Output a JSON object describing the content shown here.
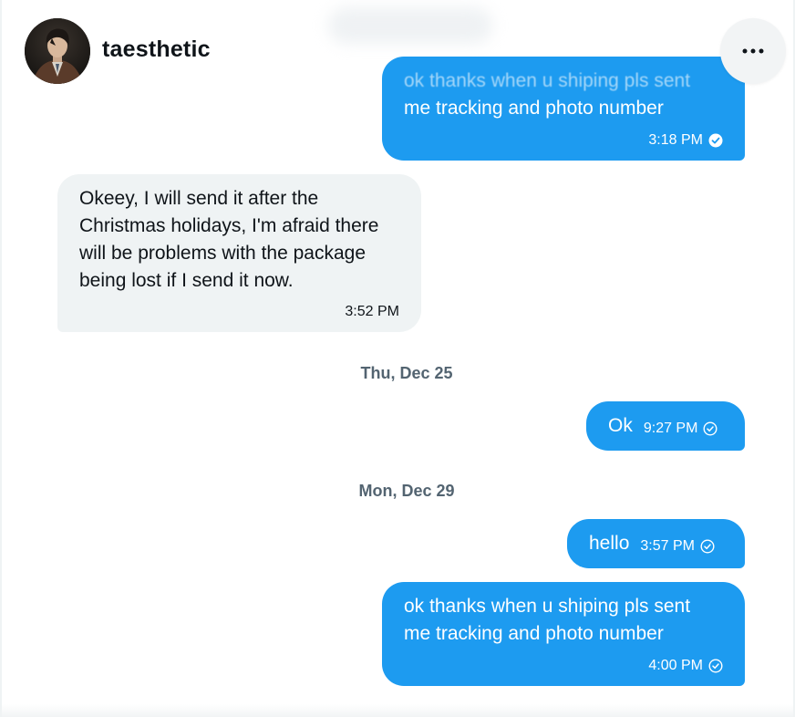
{
  "header": {
    "user_name": "taesthetic",
    "avatar_icon": "avatar-photo"
  },
  "conversation": {
    "messages": [
      {
        "direction": "outgoing",
        "text_line1": "ok thanks when u shiping pls sent",
        "text_line2": "me tracking and photo number",
        "time": "3:18 PM",
        "status": "read"
      },
      {
        "direction": "incoming",
        "text": "Okeey, I will send it after the Christmas holidays, I'm afraid there will be problems with the package being lost if I send it now.",
        "time": "3:52 PM"
      },
      {
        "direction": "outgoing",
        "text": "Ok",
        "time": "9:27 PM",
        "status": "sent"
      },
      {
        "direction": "outgoing",
        "text": "hello",
        "time": "3:57 PM",
        "status": "sent"
      },
      {
        "direction": "outgoing",
        "text_line1": "ok thanks when u shiping pls sent",
        "text_line2": "me tracking and photo number",
        "time": "4:00 PM",
        "status": "sent"
      }
    ],
    "date_separators": [
      "Thu, Dec 25",
      "Mon, Dec 29"
    ]
  },
  "colors": {
    "outgoing_bubble": "#1d9bf0",
    "incoming_bubble": "#eff3f4",
    "date_text": "#536471"
  }
}
